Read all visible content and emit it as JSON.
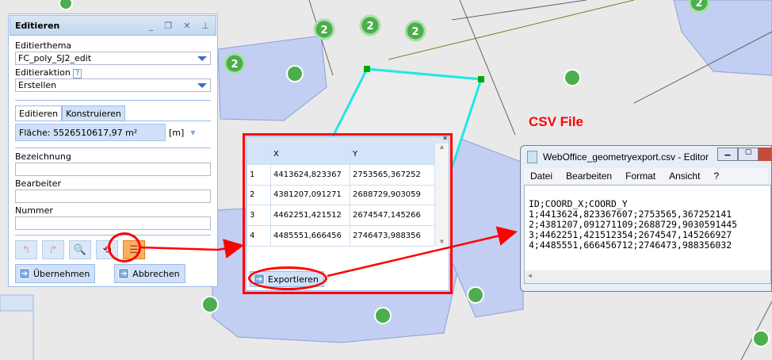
{
  "panel": {
    "title": "Editieren",
    "editierthema_label": "Editierthema",
    "editierthema_value": "FC_poly_SJ2_edit",
    "editieraktion_label": "Editieraktion",
    "help": "?",
    "editieraktion_value": "Erstellen",
    "tabs": [
      "Editieren",
      "Konstruieren"
    ],
    "area": "Fläche: 5526510617,97 m²",
    "unit": "[m]",
    "fields": [
      "Bezeichnung",
      "Bearbeiter",
      "Nummer"
    ],
    "apply": "Übernehmen",
    "cancel": "Abbrechen"
  },
  "grid": {
    "columns": [
      "",
      "X",
      "Y"
    ],
    "rows": [
      [
        "1",
        "4413624,823367",
        "2753565,367252"
      ],
      [
        "2",
        "4381207,091271",
        "2688729,903059"
      ],
      [
        "3",
        "4462251,421512",
        "2674547,145266"
      ],
      [
        "4",
        "4485551,666456",
        "2746473,988356"
      ]
    ],
    "export": "Exportieren"
  },
  "annotation": "CSV File",
  "notepad": {
    "title": "WebOffice_geometryexport.csv - Editor",
    "menu": [
      "Datei",
      "Bearbeiten",
      "Format",
      "Ansicht",
      "?"
    ],
    "lines": [
      "ID;COORD_X;COORD_Y",
      "1;4413624,823367607;2753565,367252141",
      "2;4381207,091271109;2688729,9030591445",
      "3;4462251,421512354;2674547,145266927",
      "4;4485551,666456712;2746473,988356032"
    ]
  },
  "map": {
    "cluster_label": "2"
  }
}
